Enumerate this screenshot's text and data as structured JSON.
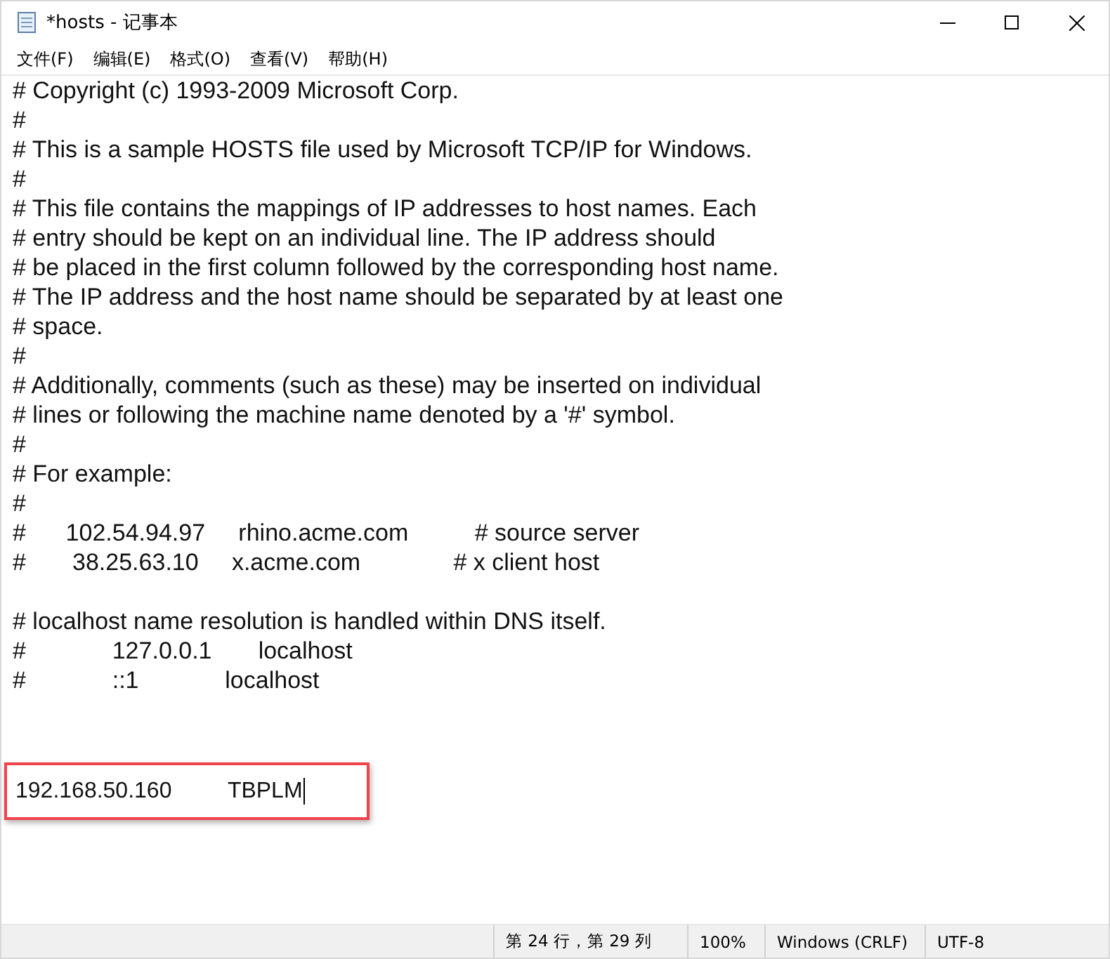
{
  "window": {
    "title": "*hosts - 记事本"
  },
  "menu": [
    "文件(F)",
    "编辑(E)",
    "格式(O)",
    "查看(V)",
    "帮助(H)"
  ],
  "lines": [
    {
      "kind": "text",
      "text": "# Copyright (c) 1993-2009 Microsoft Corp."
    },
    {
      "kind": "text",
      "text": "#"
    },
    {
      "kind": "text",
      "text": "# This is a sample HOSTS file used by Microsoft TCP/IP for Windows."
    },
    {
      "kind": "text",
      "text": "#"
    },
    {
      "kind": "text",
      "text": "# This file contains the mappings of IP addresses to host names. Each"
    },
    {
      "kind": "text",
      "text": "# entry should be kept on an individual line. The IP address should"
    },
    {
      "kind": "text",
      "text": "# be placed in the first column followed by the corresponding host name."
    },
    {
      "kind": "text",
      "text": "# The IP address and the host name should be separated by at least one"
    },
    {
      "kind": "text",
      "text": "# space."
    },
    {
      "kind": "text",
      "text": "#"
    },
    {
      "kind": "text",
      "text": "# Additionally, comments (such as these) may be inserted on individual"
    },
    {
      "kind": "text",
      "text": "# lines or following the machine name denoted by a '#' symbol."
    },
    {
      "kind": "text",
      "text": "#"
    },
    {
      "kind": "text",
      "text": "# For example:"
    },
    {
      "kind": "text",
      "text": "#"
    },
    {
      "kind": "text",
      "text": "#      102.54.94.97     rhino.acme.com          # source server"
    },
    {
      "kind": "text",
      "text": "#       38.25.63.10     x.acme.com              # x client host"
    },
    {
      "kind": "blank"
    },
    {
      "kind": "text",
      "text": "# localhost name resolution is handled within DNS itself."
    },
    {
      "kind": "text",
      "text": "#             127.0.0.1       localhost"
    },
    {
      "kind": "text",
      "text": "#             ::1             localhost"
    },
    {
      "kind": "blank"
    },
    {
      "kind": "blank"
    },
    {
      "kind": "highlighted",
      "text": "192.168.50.160         TBPLM",
      "cursor": true
    }
  ],
  "status_bar": [
    "第 24 行，第 29 列",
    "100%",
    "Windows (CRLF)",
    "UTF-8"
  ]
}
